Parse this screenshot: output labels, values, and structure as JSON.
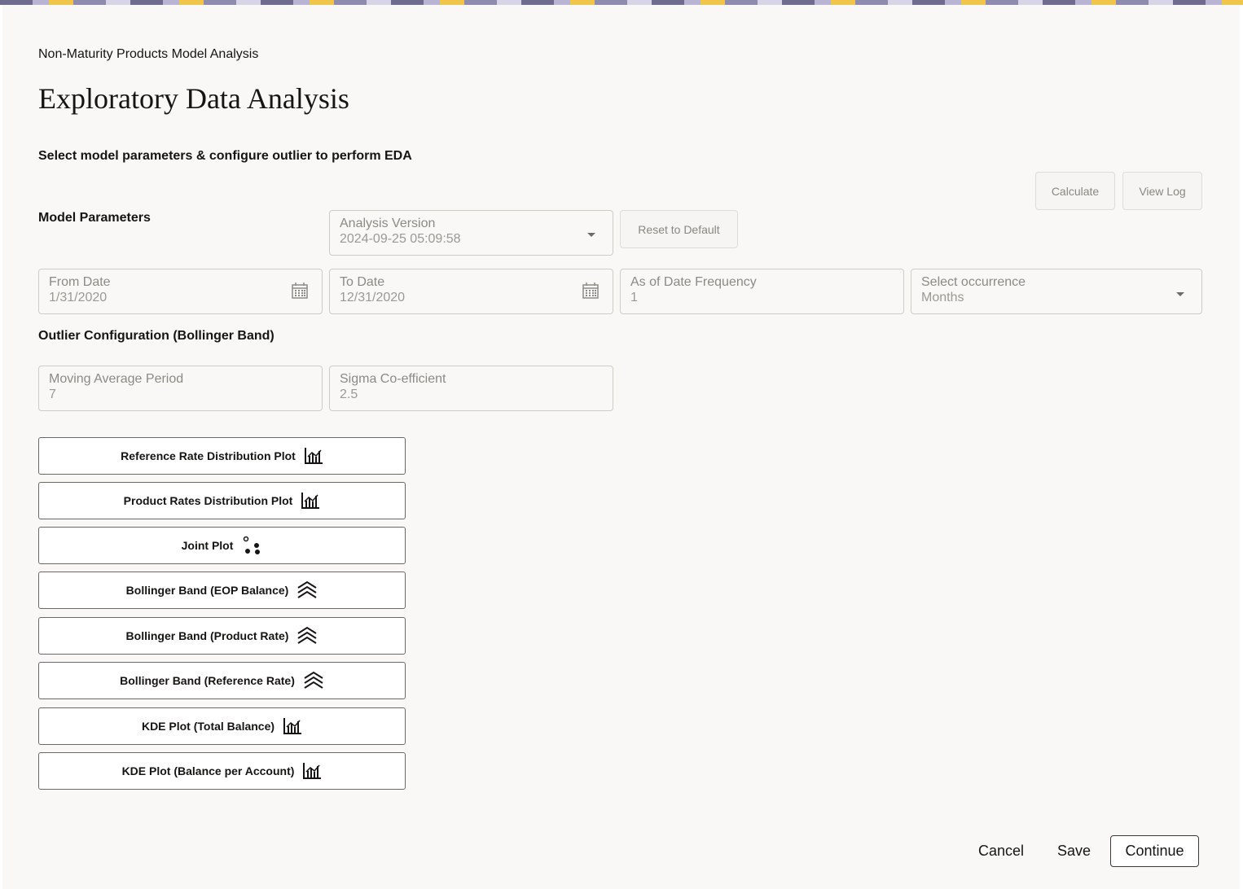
{
  "breadcrumb": "Non-Maturity Products Model Analysis",
  "title": "Exploratory Data Analysis",
  "subtitle": "Select model parameters & configure outlier to perform EDA",
  "toolbar": {
    "calculate": "Calculate",
    "view_log": "View Log"
  },
  "model_parameters": {
    "label": "Model Parameters",
    "analysis_version": {
      "label": "Analysis Version",
      "value": "2024-09-25 05:09:58"
    },
    "reset": "Reset to Default",
    "from_date": {
      "label": "From Date",
      "value": "1/31/2020"
    },
    "to_date": {
      "label": "To Date",
      "value": "12/31/2020"
    },
    "frequency": {
      "label": "As of Date Frequency",
      "value": "1"
    },
    "occurrence": {
      "label": "Select occurrence",
      "value": "Months"
    }
  },
  "outlier": {
    "label": "Outlier Configuration (Bollinger Band)",
    "moving_average": {
      "label": "Moving Average Period",
      "value": "7"
    },
    "sigma": {
      "label": "Sigma Co-efficient",
      "value": "2.5"
    }
  },
  "plots": [
    {
      "label": "Reference Rate Distribution Plot",
      "icon": "bar-chart-icon"
    },
    {
      "label": "Product Rates Distribution Plot",
      "icon": "bar-chart-icon"
    },
    {
      "label": "Joint Plot",
      "icon": "scatter-icon"
    },
    {
      "label": "Bollinger Band (EOP Balance)",
      "icon": "chevrons-up-icon"
    },
    {
      "label": "Bollinger Band (Product Rate)",
      "icon": "chevrons-up-icon"
    },
    {
      "label": "Bollinger Band (Reference Rate)",
      "icon": "chevrons-up-icon"
    },
    {
      "label": "KDE Plot (Total Balance)",
      "icon": "bar-chart-icon"
    },
    {
      "label": "KDE Plot (Balance per Account)",
      "icon": "bar-chart-icon"
    }
  ],
  "footer": {
    "cancel": "Cancel",
    "save": "Save",
    "continue": "Continue"
  }
}
